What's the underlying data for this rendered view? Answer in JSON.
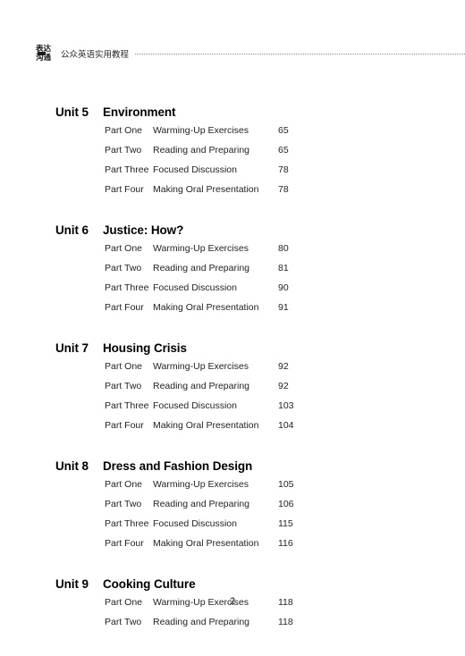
{
  "header": {
    "logo": {
      "top_text": "表达",
      "bottom_text": "沟通"
    },
    "series_title": "公众英语实用教程"
  },
  "toc": {
    "units": [
      {
        "number": "Unit 5",
        "title": "Environment",
        "parts": [
          {
            "label": "Part One",
            "title": "Warming-Up Exercises",
            "page": "65"
          },
          {
            "label": "Part Two",
            "title": "Reading and Preparing",
            "page": "65"
          },
          {
            "label": "Part Three",
            "title": "Focused Discussion",
            "page": "78"
          },
          {
            "label": "Part Four",
            "title": "Making Oral Presentation",
            "page": "78"
          }
        ]
      },
      {
        "number": "Unit 6",
        "title": "Justice: How?",
        "parts": [
          {
            "label": "Part One",
            "title": "Warming-Up Exercises",
            "page": "80"
          },
          {
            "label": "Part Two",
            "title": "Reading and Preparing",
            "page": "81"
          },
          {
            "label": "Part Three",
            "title": "Focused Discussion",
            "page": "90"
          },
          {
            "label": "Part Four",
            "title": "Making Oral Presentation",
            "page": "91"
          }
        ]
      },
      {
        "number": "Unit 7",
        "title": "Housing Crisis",
        "parts": [
          {
            "label": "Part One",
            "title": "Warming-Up Exercises",
            "page": "92"
          },
          {
            "label": "Part Two",
            "title": "Reading and Preparing",
            "page": "92"
          },
          {
            "label": "Part Three",
            "title": "Focused Discussion",
            "page": "103"
          },
          {
            "label": "Part Four",
            "title": "Making Oral Presentation",
            "page": "104"
          }
        ]
      },
      {
        "number": "Unit 8",
        "title": "Dress and Fashion Design",
        "parts": [
          {
            "label": "Part One",
            "title": "Warming-Up Exercises",
            "page": "105"
          },
          {
            "label": "Part Two",
            "title": "Reading and Preparing",
            "page": "106"
          },
          {
            "label": "Part Three",
            "title": "Focused Discussion",
            "page": "115"
          },
          {
            "label": "Part Four",
            "title": "Making Oral Presentation",
            "page": "116"
          }
        ]
      },
      {
        "number": "Unit 9",
        "title": "Cooking Culture",
        "parts": [
          {
            "label": "Part One",
            "title": "Warming-Up Exercises",
            "page": "118"
          },
          {
            "label": "Part Two",
            "title": "Reading and Preparing",
            "page": "118"
          }
        ]
      }
    ]
  },
  "footer": {
    "page_number": "2"
  }
}
